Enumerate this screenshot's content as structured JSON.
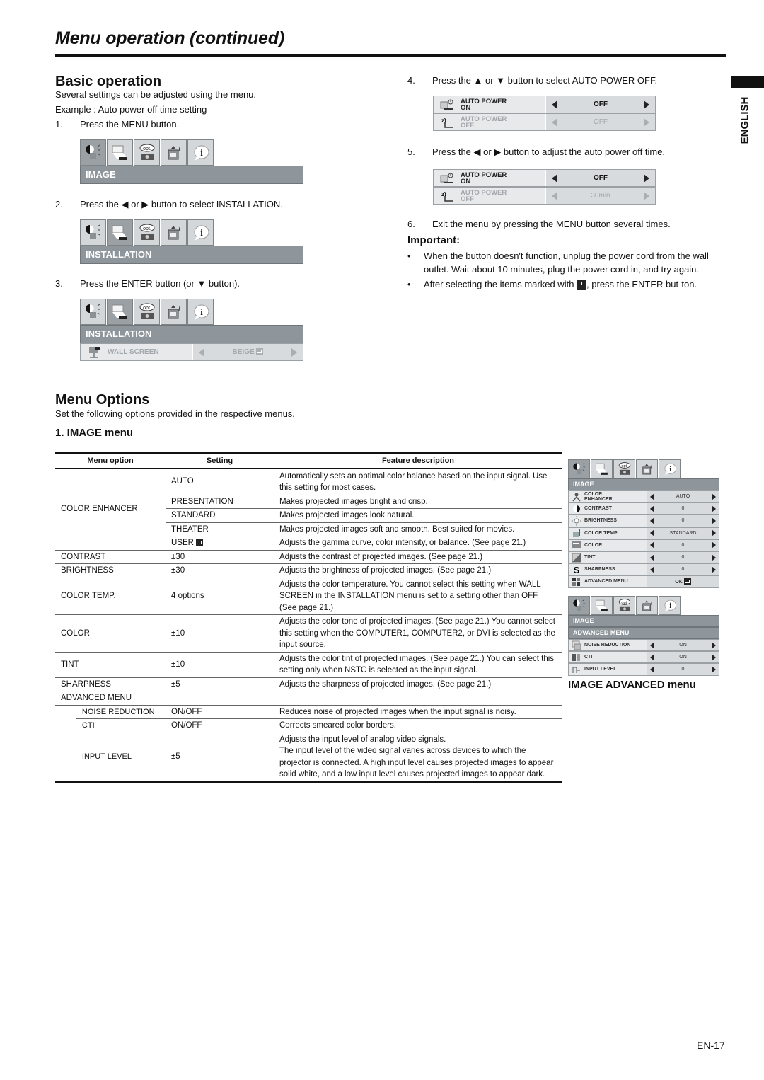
{
  "page": {
    "title": "Menu operation (continued)",
    "language_tab": "ENGLISH",
    "page_number": "EN-17"
  },
  "basic": {
    "heading": "Basic operation",
    "intro": "Several settings can be adjusted using the menu.",
    "example": "Example : Auto power off time setting",
    "steps": [
      {
        "num": "1.",
        "text": "Press the MENU button."
      },
      {
        "num": "2.",
        "text": "Press the ◀ or ▶ button to select INSTALLATION."
      },
      {
        "num": "3.",
        "text": "Press the ENTER button (or ▼ button)."
      },
      {
        "num": "4.",
        "text": "Press the ▲ or ▼ button to select AUTO POWER OFF."
      },
      {
        "num": "5.",
        "text": "Press the ◀ or ▶ button to adjust the auto power off time."
      },
      {
        "num": "6.",
        "text": "Exit the menu by pressing the MENU button several times."
      }
    ],
    "osd1": {
      "bar": "IMAGE",
      "active_tab": "image"
    },
    "osd2": {
      "bar": "INSTALLATION",
      "active_tab": "installation"
    },
    "osd3": {
      "bar": "INSTALLATION",
      "active_tab": "installation",
      "row_label": "WALL SCREEN",
      "row_value": "BEIGE"
    },
    "tabs": [
      "image-tab",
      "installation-tab",
      "options-tab",
      "signal-tab",
      "info-tab"
    ],
    "tab_opt_label": "opt.",
    "osd4": {
      "rows": [
        {
          "label1": "AUTO POWER",
          "label2": "ON",
          "value": "OFF",
          "dim": false
        },
        {
          "label1": "AUTO POWER",
          "label2": "OFF",
          "value": "OFF",
          "dim": true
        }
      ]
    },
    "osd5": {
      "rows": [
        {
          "label1": "AUTO POWER",
          "label2": "ON",
          "value": "OFF",
          "dim": false
        },
        {
          "label1": "AUTO POWER",
          "label2": "OFF",
          "value": "30min",
          "dim": true
        }
      ]
    },
    "important": {
      "heading": "Important:",
      "bullets": [
        "When the button doesn't function, unplug the power cord from the wall outlet. Wait about 10 minutes, plug the power cord in, and try again.",
        "After selecting the items marked with",
        ", press the ENTER but-ton."
      ]
    }
  },
  "menu_options": {
    "heading": "Menu Options",
    "intro": "Set the following options provided in the respective menus.",
    "subheading": "1. IMAGE menu",
    "table": {
      "headers": [
        "Menu option",
        "Setting",
        "Feature description"
      ],
      "color_enhancer": {
        "option": "COLOR ENHANCER",
        "rows": [
          {
            "setting": "AUTO",
            "desc": "Automatically sets an optimal color balance based on the input signal. Use this setting for most cases."
          },
          {
            "setting": "PRESENTATION",
            "desc": "Makes projected images bright and crisp."
          },
          {
            "setting": "STANDARD",
            "desc": "Makes projected images look natural."
          },
          {
            "setting": "THEATER",
            "desc": "Makes projected images soft and smooth. Best suited for movies."
          },
          {
            "setting": "USER",
            "desc": "Adjusts the gamma curve, color intensity, or balance. (See page 21.)"
          }
        ]
      },
      "rows": [
        {
          "option": "CONTRAST",
          "setting": "±30",
          "desc": "Adjusts the contrast of projected images. (See page 21.)"
        },
        {
          "option": "BRIGHTNESS",
          "setting": "±30",
          "desc": "Adjusts the brightness of projected images. (See page 21.)"
        },
        {
          "option": "COLOR TEMP.",
          "setting": "4 options",
          "desc": "Adjusts the color temperature. You cannot select this setting when WALL SCREEN in the INSTALLATION menu is set to a setting other than OFF. (See page 21.)"
        },
        {
          "option": "COLOR",
          "setting": "±10",
          "desc": "Adjusts the color tone of projected images. (See page 21.)  You cannot select this setting when the COMPUTER1, COMPUTER2, or DVI is selected as the input source."
        },
        {
          "option": "TINT",
          "setting": "±10",
          "desc": "Adjusts the color tint of projected images.  (See page 21.) You can select this setting only when NSTC is selected as the input signal."
        },
        {
          "option": "SHARPNESS",
          "setting": "±5",
          "desc": "Adjusts the sharpness of projected images. (See page 21.)"
        }
      ],
      "advanced_label": "ADVANCED MENU",
      "advanced_rows": [
        {
          "option": "NOISE REDUCTION",
          "setting": "ON/OFF",
          "desc": "Reduces noise of projected images when the input signal is noisy."
        },
        {
          "option": "CTI",
          "setting": "ON/OFF",
          "desc": "Corrects smeared color borders."
        },
        {
          "option": "INPUT LEVEL",
          "setting": "±5",
          "desc": "Adjusts the input level of analog video signals.\nThe input level of the video signal varies across devices to which the projector is connected. A high input level causes projected images to appear solid white, and a low input level causes projected images to appear dark."
        }
      ]
    },
    "image_osd": {
      "bar": "IMAGE",
      "rows": [
        {
          "icon": "color-enhancer-icon",
          "label": "COLOR ENHANCER",
          "value": "AUTO"
        },
        {
          "icon": "contrast-icon",
          "label": "CONTRAST",
          "value": "0"
        },
        {
          "icon": "brightness-icon",
          "label": "BRIGHTNESS",
          "value": "0"
        },
        {
          "icon": "color-temp-icon",
          "label": "COLOR TEMP.",
          "value": "STANDARD"
        },
        {
          "icon": "color-icon",
          "label": "COLOR",
          "value": "0"
        },
        {
          "icon": "tint-icon",
          "label": "TINT",
          "value": "0"
        },
        {
          "icon": "sharpness-icon",
          "label": "SHARPNESS",
          "value": "0"
        },
        {
          "icon": "advanced-menu-icon",
          "label": "ADVANCED MENU",
          "value": "OK"
        }
      ]
    },
    "advanced_osd": {
      "bar1": "IMAGE",
      "bar2": "ADVANCED MENU",
      "rows": [
        {
          "icon": "noise-reduction-icon",
          "label": "NOISE REDUCTION",
          "value": "ON"
        },
        {
          "icon": "cti-icon",
          "label": "CTI",
          "value": "ON"
        },
        {
          "icon": "input-level-icon",
          "label": "INPUT LEVEL",
          "value": "0"
        }
      ],
      "caption": "IMAGE ADVANCED menu"
    }
  }
}
